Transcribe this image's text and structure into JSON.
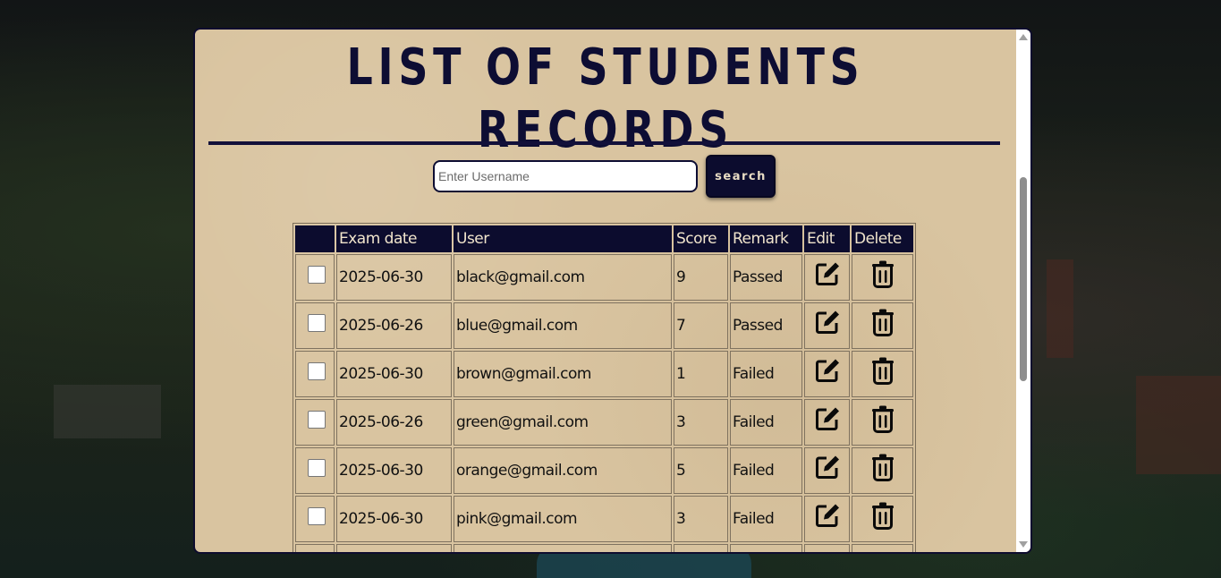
{
  "page": {
    "title": "LIST OF STUDENTS RECORDS"
  },
  "search": {
    "placeholder": "Enter Username",
    "value": "",
    "button_label": "search"
  },
  "table": {
    "headers": [
      "",
      "Exam date",
      "User",
      "Score",
      "Remark",
      "Edit",
      "Delete"
    ],
    "rows": [
      {
        "checked": false,
        "exam_date": "2025-06-30",
        "user": "black@gmail.com",
        "score": "9",
        "remark": "Passed",
        "edit_icon": "edit-icon",
        "delete_icon": "trash-icon"
      },
      {
        "checked": false,
        "exam_date": "2025-06-26",
        "user": "blue@gmail.com",
        "score": "7",
        "remark": "Passed",
        "edit_icon": "edit-icon",
        "delete_icon": "trash-icon"
      },
      {
        "checked": false,
        "exam_date": "2025-06-30",
        "user": "brown@gmail.com",
        "score": "1",
        "remark": "Failed",
        "edit_icon": "edit-icon",
        "delete_icon": "trash-icon"
      },
      {
        "checked": false,
        "exam_date": "2025-06-26",
        "user": "green@gmail.com",
        "score": "3",
        "remark": "Failed",
        "edit_icon": "edit-icon",
        "delete_icon": "trash-icon"
      },
      {
        "checked": false,
        "exam_date": "2025-06-30",
        "user": "orange@gmail.com",
        "score": "5",
        "remark": "Failed",
        "edit_icon": "edit-icon",
        "delete_icon": "trash-icon"
      },
      {
        "checked": false,
        "exam_date": "2025-06-30",
        "user": "pink@gmail.com",
        "score": "3",
        "remark": "Failed",
        "edit_icon": "edit-icon",
        "delete_icon": "trash-icon"
      }
    ]
  },
  "colors": {
    "navy": "#0c0c2e",
    "paper": "#d9c4a0",
    "header_text": "#f0e4cc"
  }
}
